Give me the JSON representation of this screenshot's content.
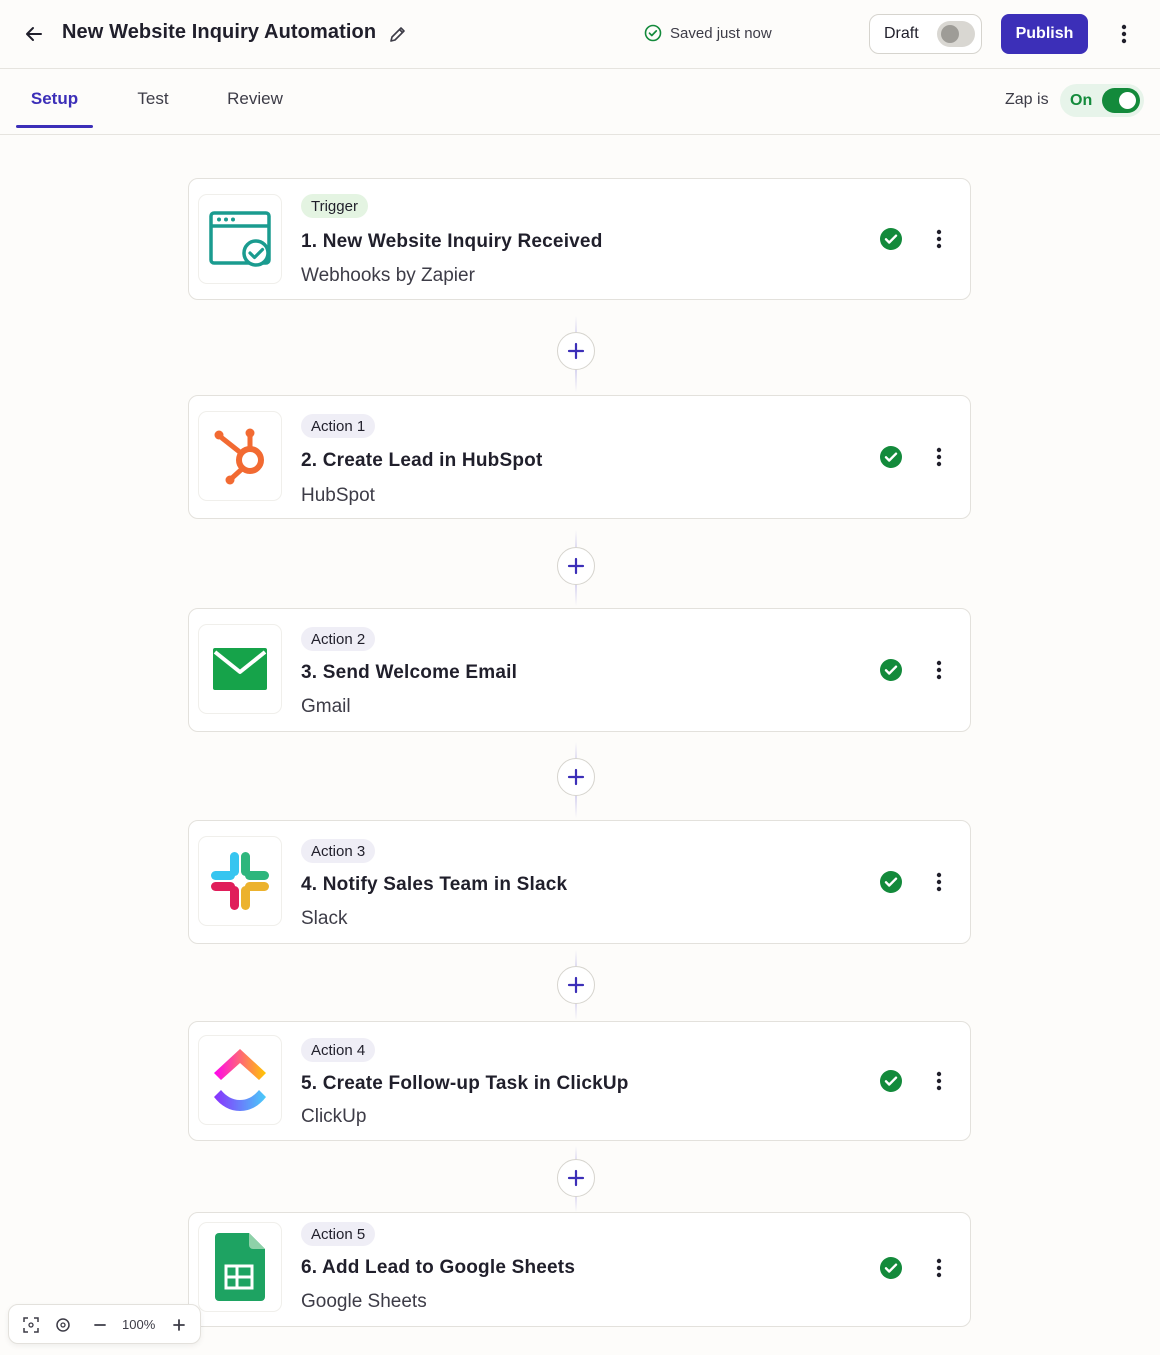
{
  "header": {
    "title": "New Website Inquiry Automation",
    "saved_status": "Saved just now",
    "draft_label": "Draft",
    "publish_label": "Publish"
  },
  "tabs": [
    {
      "label": "Setup",
      "active": true
    },
    {
      "label": "Test",
      "active": false
    },
    {
      "label": "Review",
      "active": false
    }
  ],
  "zap_status": {
    "prefix": "Zap is",
    "state": "On",
    "enabled": true
  },
  "steps": [
    {
      "badge": "Trigger",
      "title": "1. New Website Inquiry Received",
      "app": "Webhooks by Zapier",
      "icon": "webhook-icon",
      "status": "complete"
    },
    {
      "badge": "Action 1",
      "title": "2. Create Lead in HubSpot",
      "app": "HubSpot",
      "icon": "hubspot-icon",
      "status": "complete"
    },
    {
      "badge": "Action 2",
      "title": "3. Send Welcome Email",
      "app": "Gmail",
      "icon": "gmail-icon",
      "status": "complete"
    },
    {
      "badge": "Action 3",
      "title": "4. Notify Sales Team in Slack",
      "app": "Slack",
      "icon": "slack-icon",
      "status": "complete"
    },
    {
      "badge": "Action 4",
      "title": "5. Create Follow-up Task in ClickUp",
      "app": "ClickUp",
      "icon": "clickup-icon",
      "status": "complete"
    },
    {
      "badge": "Action 5",
      "title": "6. Add Lead to Google Sheets",
      "app": "Google Sheets",
      "icon": "google-sheets-icon",
      "status": "complete"
    }
  ],
  "zoom": {
    "level": "100%"
  },
  "colors": {
    "accent": "#3c2fb8",
    "success": "#138a3b",
    "trigger_badge": "#e4f4e2",
    "action_badge": "#efeef6"
  }
}
